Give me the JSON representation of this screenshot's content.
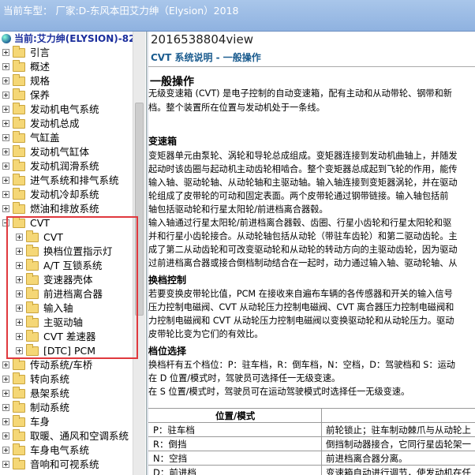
{
  "window": {
    "title": "当前车型：  厂家:D-东风本田艾力绅（Elysion）2018"
  },
  "tree": {
    "root_label": "当前:艾力绅(ELYSION)-82",
    "items": [
      {
        "label": "引言"
      },
      {
        "label": "概述"
      },
      {
        "label": "规格"
      },
      {
        "label": "保养"
      },
      {
        "label": "发动机电气系统"
      },
      {
        "label": "发动机总成"
      },
      {
        "label": "气缸盖"
      },
      {
        "label": "发动机气缸体"
      },
      {
        "label": "发动机润滑系统"
      },
      {
        "label": "进气系统和排气系统"
      },
      {
        "label": "发动机冷却系统"
      },
      {
        "label": "燃油和排放系统"
      },
      {
        "label": "CVT",
        "expanded": true
      },
      {
        "label": "CVT"
      },
      {
        "label": "换档位置指示灯"
      },
      {
        "label": "A/T 互锁系统"
      },
      {
        "label": "变速器壳体"
      },
      {
        "label": "前进档离合器"
      },
      {
        "label": "输入轴"
      },
      {
        "label": "主驱动轴"
      },
      {
        "label": "CVT 差速器"
      },
      {
        "label": "[DTC] PCM"
      },
      {
        "label": "传动系统/车桥"
      },
      {
        "label": "转向系统"
      },
      {
        "label": "悬架系统"
      },
      {
        "label": "制动系统"
      },
      {
        "label": "车身"
      },
      {
        "label": "取暖、通风和空调系统"
      },
      {
        "label": "车身电气系统"
      },
      {
        "label": "音响和可视系统"
      }
    ]
  },
  "doc": {
    "id": "2016538804view",
    "subtitle": "CVT 系统说明 - 一般操作",
    "heading": "一般操作",
    "intro": [
      "无级变速箱 (CVT) 是电子控制的自动变速箱，配有主动和从动带轮、钢带和新",
      "档。整个装置所在位置与发动机处于一条线。"
    ],
    "sec1_title": "变速箱",
    "sec1_lines": [
      "变矩器单元由泵轮、涡轮和导轮总成组成。变矩器连接到发动机曲轴上，并随发",
      "起动时该齿圈与起动机主动齿轮相啮合。整个变矩器总成起到飞轮的作用，能传",
      "输入轴、驱动轮轴、从动轮轴和主驱动轴。输入轴连接到变矩器涡轮，并在驱动",
      "轮组成了皮带轮的可动和固定表面。两个皮带轮通过钢带链接。输入轴包括前",
      "轴包括驱动轮和行星太阳轮/前进档离合器毂。",
      "输入轴通过行星太阳轮/前进档离合器毂、齿圈、行星小齿轮和行星太阳轮和驱",
      "并和行星小齿轮接合。从动轮轴包括从动轮（带驻车齿轮）和第二驱动齿轮。主",
      "成了第二从动齿轮和可改变驱动轮和从动轮的转动方向的主驱动齿轮，因为驱动",
      "过前进档离合器或接合倒档制动结合在一起时，动力通过输入轴、驱动轮轴、从"
    ],
    "sec2_title": "换档控制",
    "sec2_lines": [
      "若要变换皮带轮比值，PCM 在接收来自遍布车辆的各传感器和开关的输入信号",
      "压力控制电磁阀、CVT 从动轮压力控制电磁阀、CVT 离合器压力控制电磁阀和",
      "力控制电磁阀和 CVT 从动轮压力控制电磁阀以变换驱动轮和从动轮压力。驱动",
      "皮带轮比变为它们的有效比。"
    ],
    "sec3_title": "档位选择",
    "sec3_lines": [
      "换档杆有五个档位：P：驻车档，R：倒车档，N：空档，D：驾驶档和 S：运动",
      "在 D 位置/模式时，驾驶员可选择任一无级变速。",
      "在 S 位置/模式时，驾驶员可在运动驾驶模式时选择任一无级变速。"
    ],
    "table": {
      "header": "位置/模式",
      "rows": [
        {
          "mode": "P：驻车档",
          "desc": "前轮锁止；驻车制动棘爪与从动轮上"
        },
        {
          "mode": "R：倒挡",
          "desc": "倒挡制动器接合，它同行星齿轮架一"
        },
        {
          "mode": "N：空挡",
          "desc": "前进档离合器分离。"
        },
        {
          "mode": "D：前进档",
          "desc": "变速箱自动进行调节，使发动机在任"
        }
      ]
    }
  }
}
